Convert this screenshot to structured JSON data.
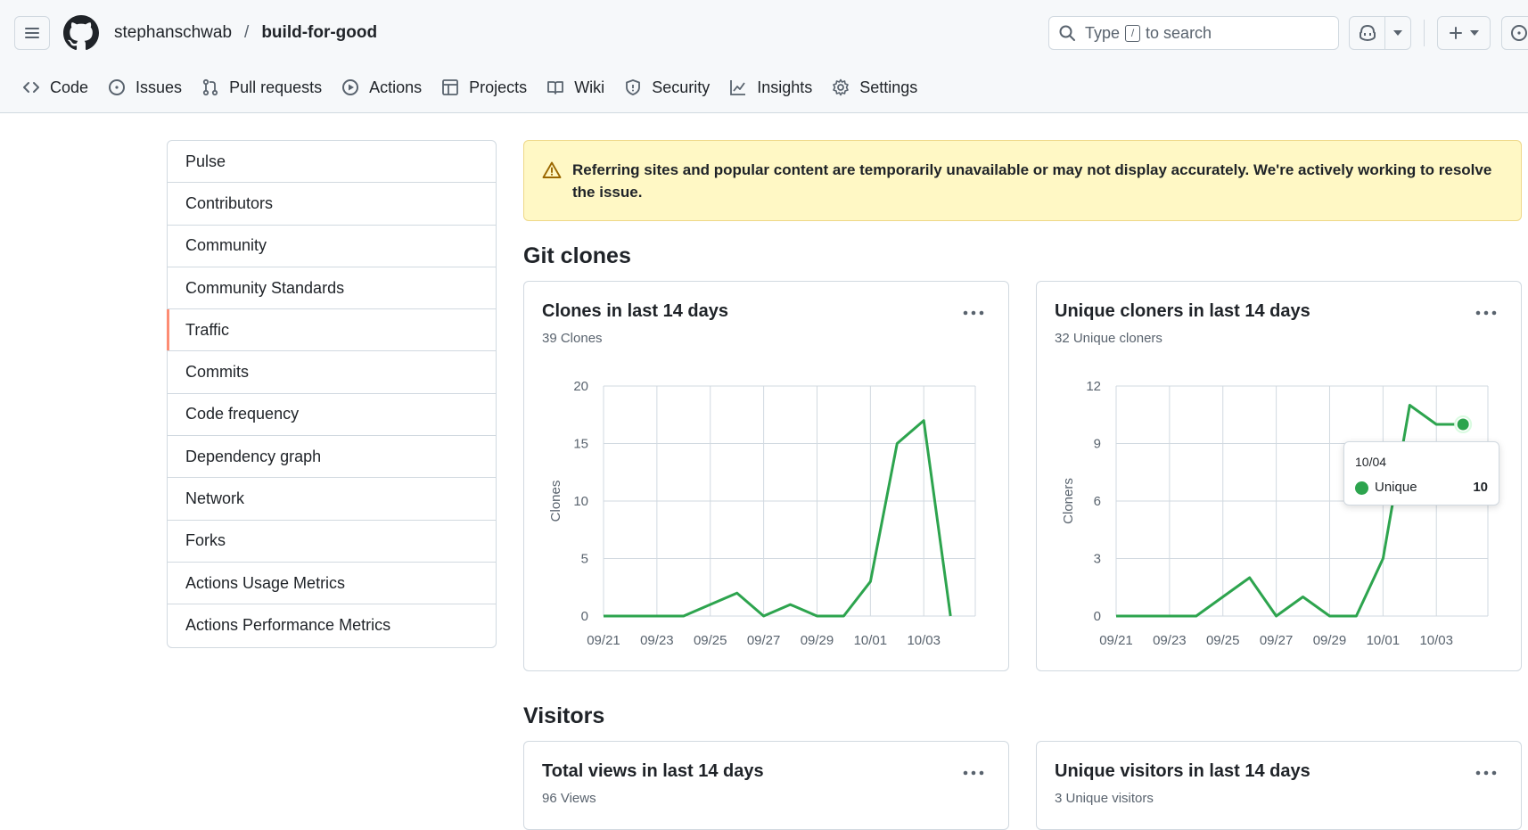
{
  "header": {
    "owner": "stephanschwab",
    "separator": "/",
    "repo": "build-for-good",
    "search_prefix": "Type",
    "search_key": "/",
    "search_suffix": "to search"
  },
  "repo_nav": [
    {
      "label": "Code",
      "icon": "code-icon"
    },
    {
      "label": "Issues",
      "icon": "issue-icon"
    },
    {
      "label": "Pull requests",
      "icon": "pull-request-icon"
    },
    {
      "label": "Actions",
      "icon": "play-icon"
    },
    {
      "label": "Projects",
      "icon": "table-icon"
    },
    {
      "label": "Wiki",
      "icon": "book-icon"
    },
    {
      "label": "Security",
      "icon": "shield-icon"
    },
    {
      "label": "Insights",
      "icon": "graph-icon"
    },
    {
      "label": "Settings",
      "icon": "gear-icon"
    }
  ],
  "sidebar": {
    "active": "Traffic",
    "items": [
      "Pulse",
      "Contributors",
      "Community",
      "Community Standards",
      "Traffic",
      "Commits",
      "Code frequency",
      "Dependency graph",
      "Network",
      "Forks",
      "Actions Usage Metrics",
      "Actions Performance Metrics"
    ]
  },
  "flash": {
    "message": "Referring sites and popular content are temporarily unavailable or may not display accurately. We're actively working to resolve the issue."
  },
  "sections": {
    "git_clones": "Git clones",
    "visitors": "Visitors"
  },
  "cards": {
    "clones": {
      "title": "Clones in last 14 days",
      "subtitle": "39 Clones"
    },
    "unique_cloners": {
      "title": "Unique cloners in last 14 days",
      "subtitle": "32 Unique cloners"
    },
    "views": {
      "title": "Total views in last 14 days",
      "subtitle": "96 Views"
    },
    "unique_visitors": {
      "title": "Unique visitors in last 14 days",
      "subtitle": "3 Unique visitors"
    }
  },
  "tooltip": {
    "date": "10/04",
    "series": "Unique",
    "value": "10"
  },
  "colors": {
    "line": "#2da44e",
    "grid": "#d1d9e0",
    "accent": "#fd8c73"
  },
  "chart_data": [
    {
      "type": "line",
      "title": "Clones in last 14 days",
      "ylabel": "Clones",
      "x": [
        "09/21",
        "09/22",
        "09/23",
        "09/24",
        "09/25",
        "09/26",
        "09/27",
        "09/28",
        "09/29",
        "09/30",
        "10/01",
        "10/02",
        "10/03",
        "10/04"
      ],
      "xticks": [
        "09/21",
        "09/23",
        "09/25",
        "09/27",
        "09/29",
        "10/01",
        "10/03"
      ],
      "yticks": [
        0,
        5,
        10,
        15,
        20
      ],
      "ylim": [
        0,
        20
      ],
      "values": [
        0,
        0,
        0,
        0,
        1,
        2,
        0,
        1,
        0,
        0,
        3,
        15,
        17,
        0
      ]
    },
    {
      "type": "line",
      "title": "Unique cloners in last 14 days",
      "ylabel": "Cloners",
      "x": [
        "09/21",
        "09/22",
        "09/23",
        "09/24",
        "09/25",
        "09/26",
        "09/27",
        "09/28",
        "09/29",
        "09/30",
        "10/01",
        "10/02",
        "10/03",
        "10/04"
      ],
      "xticks": [
        "09/21",
        "09/23",
        "09/25",
        "09/27",
        "09/29",
        "10/01",
        "10/03"
      ],
      "yticks": [
        0,
        3,
        6,
        9,
        12
      ],
      "ylim": [
        0,
        12
      ],
      "values": [
        0,
        0,
        0,
        0,
        1,
        2,
        0,
        1,
        0,
        0,
        3,
        11,
        10,
        10
      ],
      "highlight_index": 13
    }
  ]
}
